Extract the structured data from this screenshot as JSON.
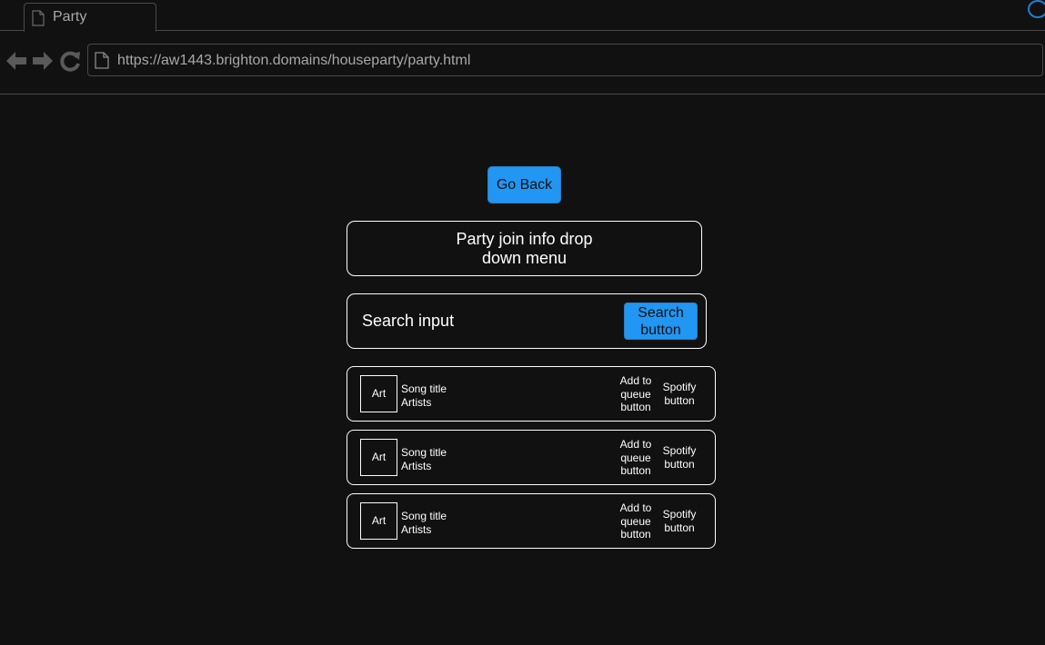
{
  "browser": {
    "tab_title": "Party",
    "url": "https://aw1443.brighton.domains/houseparty/party.html"
  },
  "page": {
    "go_back_label": "Go Back",
    "dropdown_label": "Party join info drop down menu",
    "search_placeholder": "Search input",
    "search_button_label": "Search button"
  },
  "songs": [
    {
      "art": "Art",
      "title": "Song title",
      "artists": "Artists",
      "queue_label": "Add to queue button",
      "spotify_label": "Spotify button"
    },
    {
      "art": "Art",
      "title": "Song title",
      "artists": "Artists",
      "queue_label": "Add to queue button",
      "spotify_label": "Spotify button"
    },
    {
      "art": "Art",
      "title": "Song title",
      "artists": "Artists",
      "queue_label": "Add to queue button",
      "spotify_label": "Spotify button"
    }
  ],
  "colors": {
    "background": "#111111",
    "accent": "#2196f3",
    "chrome_text": "#a8a8a8",
    "loading": "#1e7fd4"
  },
  "icons": {
    "tab": "page-icon",
    "back": "back-arrow-icon",
    "forward": "forward-arrow-icon",
    "reload": "reload-icon",
    "address": "page-icon",
    "loading": "loading-spinner-icon"
  }
}
